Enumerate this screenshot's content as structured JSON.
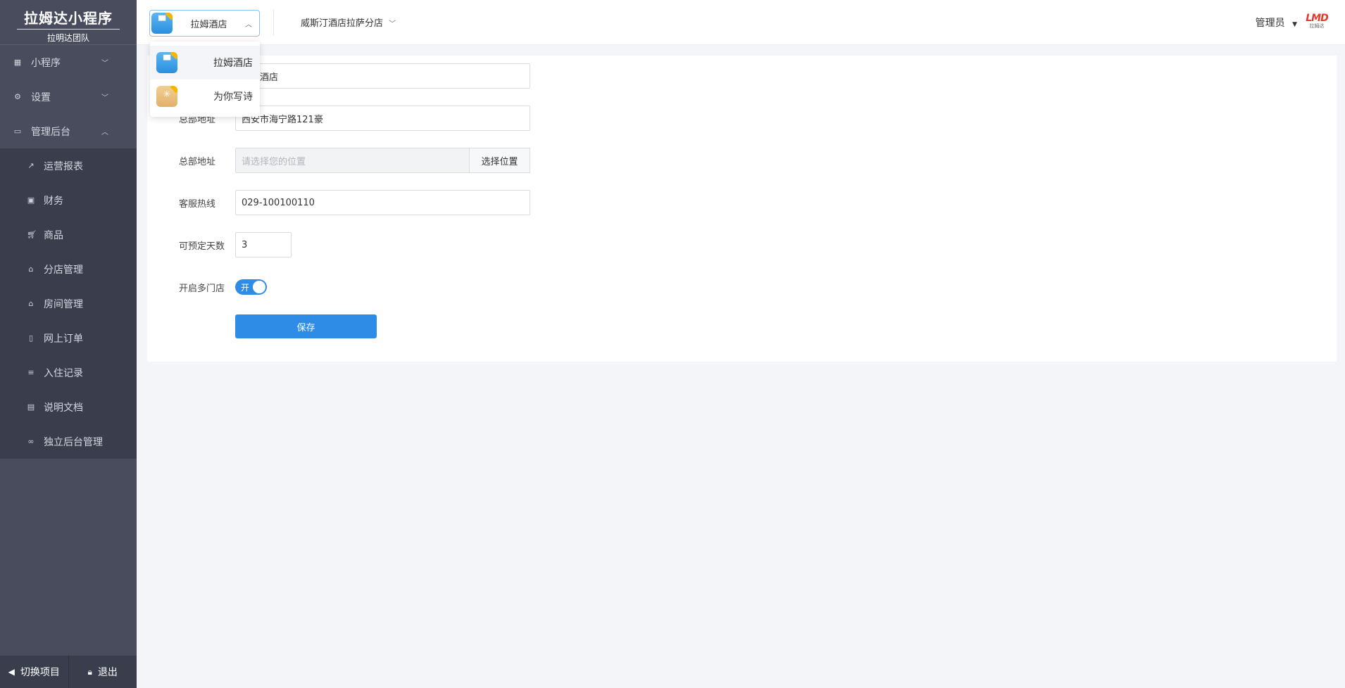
{
  "sidebar": {
    "brand_title": "拉姆达小程序",
    "brand_sub": "拉明达团队",
    "groups": [
      {
        "label": "小程序",
        "icon": "grid-icon",
        "expanded": false
      },
      {
        "label": "设置",
        "icon": "gear-icon",
        "expanded": false
      },
      {
        "label": "管理后台",
        "icon": "monitor-icon",
        "expanded": true
      }
    ],
    "items": [
      {
        "label": "运营报表",
        "icon": "trend-icon"
      },
      {
        "label": "财务",
        "icon": "money-icon"
      },
      {
        "label": "商品",
        "icon": "cart-icon"
      },
      {
        "label": "分店管理",
        "icon": "home-icon"
      },
      {
        "label": "房间管理",
        "icon": "room-icon"
      },
      {
        "label": "网上订单",
        "icon": "phone-icon"
      },
      {
        "label": "入住记录",
        "icon": "list-icon"
      },
      {
        "label": "说明文档",
        "icon": "file-icon"
      },
      {
        "label": "独立后台管理",
        "icon": "link-icon"
      }
    ],
    "footer": {
      "switch_label": "切换项目",
      "logout_label": "退出"
    }
  },
  "header": {
    "project_selected": "拉姆酒店",
    "branch": "威斯汀酒店拉萨分店",
    "user": "管理员",
    "logo_text": "LMD",
    "logo_sub": "拉姆达"
  },
  "dropdown": {
    "items": [
      {
        "label": "拉姆酒店",
        "color": "#2a8ee0",
        "active": true
      },
      {
        "label": "为你写诗",
        "color": "#e2b06a",
        "active": false
      }
    ]
  },
  "form": {
    "name_value": "拉姆酒店",
    "address_label": "总部地址",
    "address_value": "西安市海宁路121豪",
    "location_label": "总部地址",
    "location_placeholder": "请选择您的位置",
    "location_button": "选择位置",
    "hotline_label": "客服热线",
    "hotline_value": "029-100100110",
    "days_label": "可预定天数",
    "days_value": "3",
    "multi_store_label": "开启多门店",
    "multi_store_toggle_text": "开",
    "multi_store_on": true,
    "save_label": "保存"
  },
  "colors": {
    "accent": "#2f8ce6",
    "sidebar_bg": "#484c5c",
    "submenu_bg": "#3a3e4c"
  }
}
